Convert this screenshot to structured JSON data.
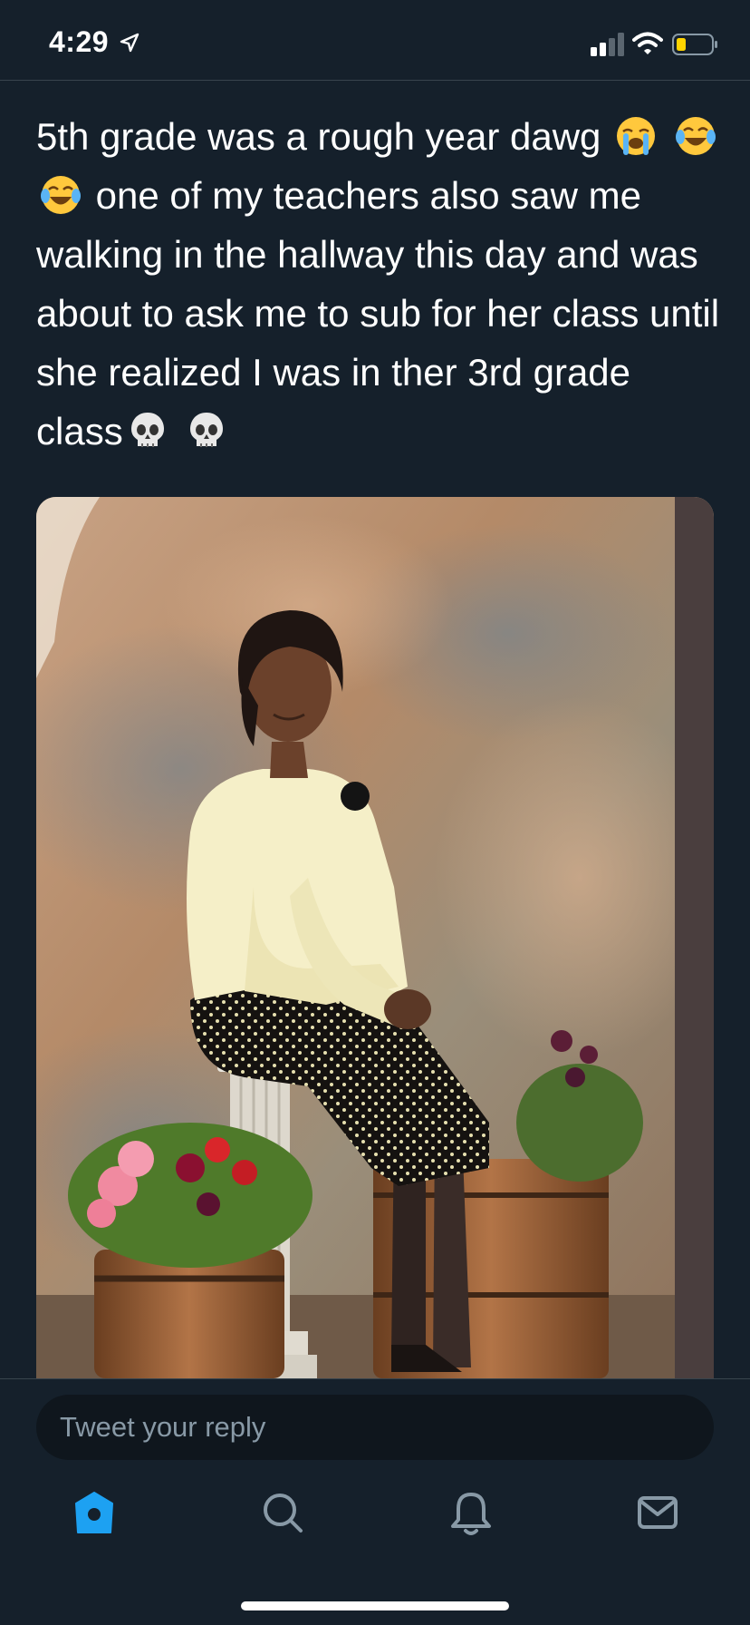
{
  "status_bar": {
    "time": "4:29",
    "icons": [
      "location-arrow-icon",
      "signal-icon",
      "wifi-icon",
      "battery-icon"
    ]
  },
  "tweet": {
    "text_segments": [
      "5th grade was a rough year dawg",
      "one of my teachers also saw me walking in the hallway this day and was about to ask me to sub for her class until she realized I was in ther 3rd grade class"
    ],
    "emojis": [
      "loudly-crying-face-emoji",
      "face-with-tears-of-joy-emoji",
      "face-with-tears-of-joy-emoji",
      "skull-emoji",
      "skull-emoji"
    ],
    "media": {
      "type": "photo"
    }
  },
  "reply": {
    "placeholder": "Tweet your reply"
  },
  "tab_bar": {
    "tabs": [
      {
        "name": "home",
        "icon": "home-icon",
        "active": true
      },
      {
        "name": "search",
        "icon": "search-icon",
        "active": false
      },
      {
        "name": "notifications",
        "icon": "bell-icon",
        "active": false
      },
      {
        "name": "messages",
        "icon": "mail-icon",
        "active": false
      }
    ],
    "active_color": "#1da1f2",
    "inactive_color": "#8899a6"
  },
  "colors": {
    "background": "#15202b",
    "divider": "#38444d",
    "text": "#ffffff",
    "battery_level_color": "#ffd400"
  }
}
